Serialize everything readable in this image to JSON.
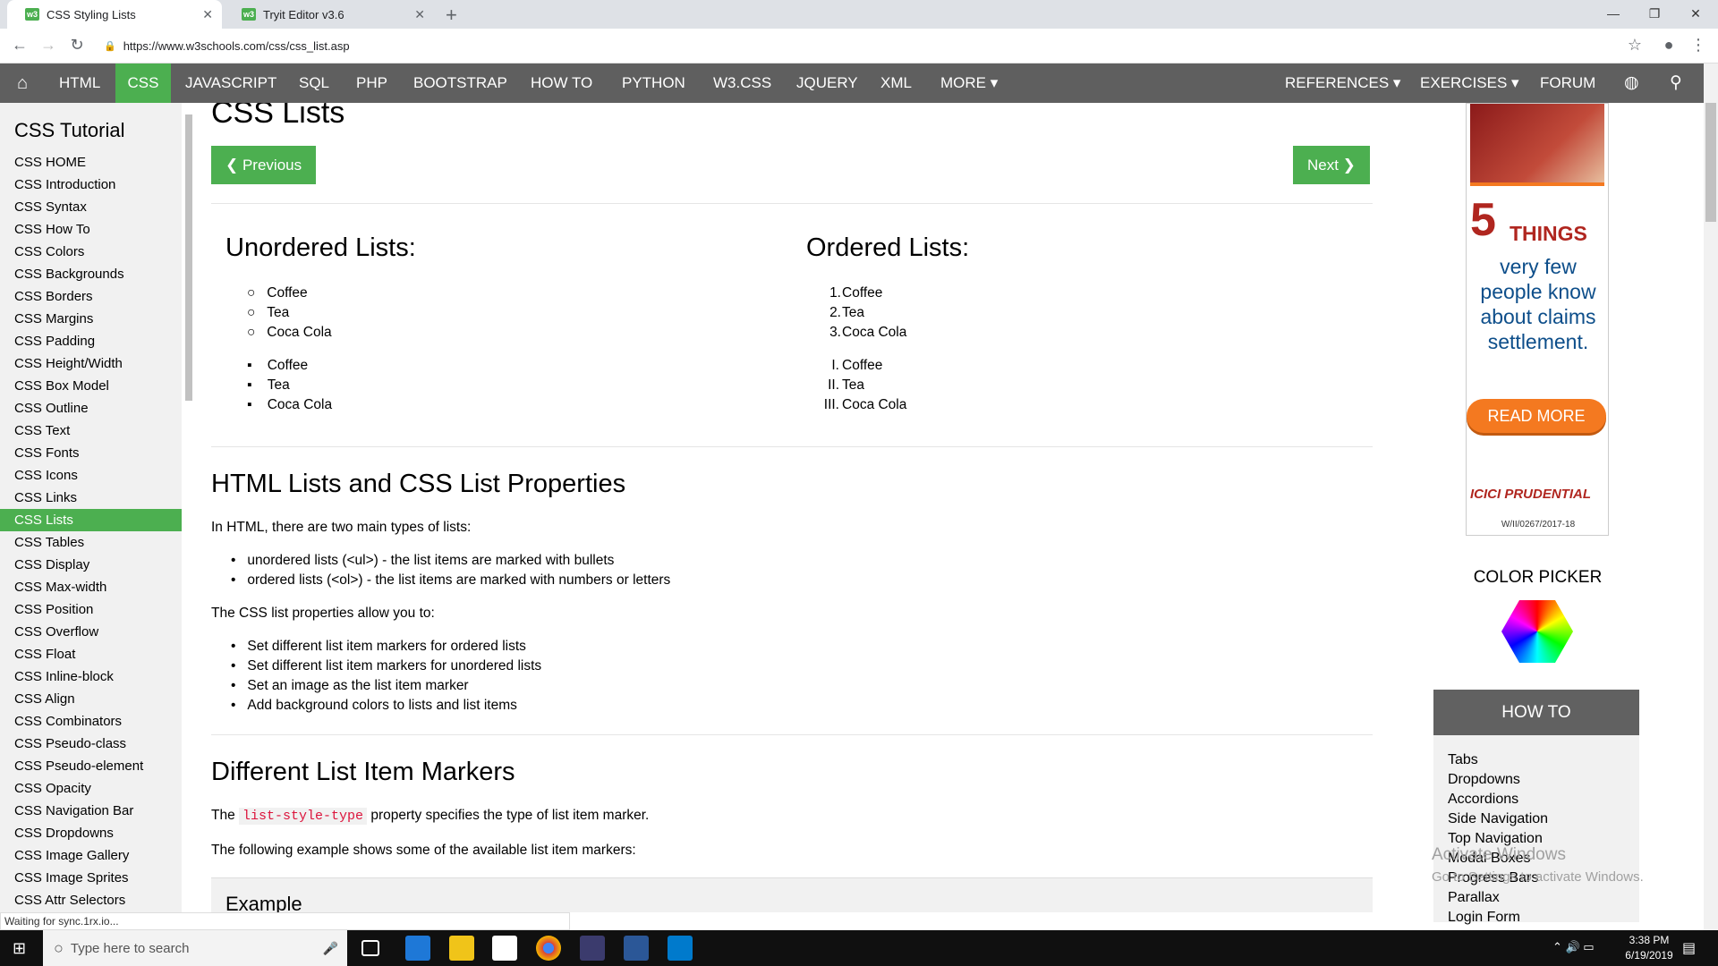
{
  "browser": {
    "tabs": [
      {
        "title": "CSS Styling Lists"
      },
      {
        "title": "Tryit Editor v3.6"
      }
    ],
    "url": "https://www.w3schools.com/css/css_list.asp",
    "status_text": "Waiting for sync.1rx.io..."
  },
  "nav": {
    "items": [
      "HTML",
      "CSS",
      "JAVASCRIPT",
      "SQL",
      "PHP",
      "BOOTSTRAP",
      "HOW TO",
      "PYTHON",
      "W3.CSS",
      "JQUERY",
      "XML",
      "MORE ▾"
    ],
    "right_items": [
      "REFERENCES ▾",
      "EXERCISES ▾",
      "FORUM"
    ],
    "active": "CSS"
  },
  "sidebar": {
    "title": "CSS Tutorial",
    "links": [
      "CSS HOME",
      "CSS Introduction",
      "CSS Syntax",
      "CSS How To",
      "CSS Colors",
      "CSS Backgrounds",
      "CSS Borders",
      "CSS Margins",
      "CSS Padding",
      "CSS Height/Width",
      "CSS Box Model",
      "CSS Outline",
      "CSS Text",
      "CSS Fonts",
      "CSS Icons",
      "CSS Links",
      "CSS Lists",
      "CSS Tables",
      "CSS Display",
      "CSS Max-width",
      "CSS Position",
      "CSS Overflow",
      "CSS Float",
      "CSS Inline-block",
      "CSS Align",
      "CSS Combinators",
      "CSS Pseudo-class",
      "CSS Pseudo-element",
      "CSS Opacity",
      "CSS Navigation Bar",
      "CSS Dropdowns",
      "CSS Image Gallery",
      "CSS Image Sprites",
      "CSS Attr Selectors"
    ],
    "active": "CSS Lists"
  },
  "main": {
    "title": "CSS Lists",
    "prev_label": "❮ Previous",
    "next_label": "Next ❯",
    "unordered_title": "Unordered Lists:",
    "ordered_title": "Ordered Lists:",
    "list_items": [
      "Coffee",
      "Tea",
      "Coca Cola"
    ],
    "roman_markers": [
      "I.",
      "II.",
      "III."
    ],
    "num_markers": [
      "1.",
      "2.",
      "3."
    ],
    "section1_title": "HTML Lists and CSS List Properties",
    "section1_intro": "In HTML, there are two main types of lists:",
    "section1_bullets": [
      "unordered lists (<ul>) - the list items are marked with bullets",
      "ordered lists (<ol>) - the list items are marked with numbers or letters"
    ],
    "section1_p2": "The CSS list properties allow you to:",
    "section1_bullets2": [
      "Set different list item markers for ordered lists",
      "Set different list item markers for unordered lists",
      "Set an image as the list item marker",
      "Add background colors to lists and list items"
    ],
    "section2_title": "Different List Item Markers",
    "section2_p1_pre": "The",
    "section2_code": "list-style-type",
    "section2_p1_post": "property specifies the type of list item marker.",
    "section2_p2": "The following example shows some of the available list item markers:",
    "example_title": "Example"
  },
  "right": {
    "ad": {
      "big": "5",
      "things": "THINGS",
      "text": "very few people know about claims settlement.",
      "button": "READ MORE",
      "logo": "ICICI PRUDENTIAL",
      "code": "W/II/0267/2017-18"
    },
    "color_picker_title": "COLOR PICKER",
    "howto_title": "HOW TO",
    "howto_links": [
      "Tabs",
      "Dropdowns",
      "Accordions",
      "Side Navigation",
      "Top Navigation",
      "Modal Boxes",
      "Progress Bars",
      "Parallax",
      "Login Form"
    ],
    "watermark_1": "Activate Windows",
    "watermark_2": "Go to Settings to activate Windows."
  },
  "taskbar": {
    "search_placeholder": "Type here to search",
    "time": "3:38 PM",
    "date": "6/19/2019"
  },
  "colors": {
    "w3_green": "#4caf50",
    "nav_gray": "#5f5f5f"
  }
}
